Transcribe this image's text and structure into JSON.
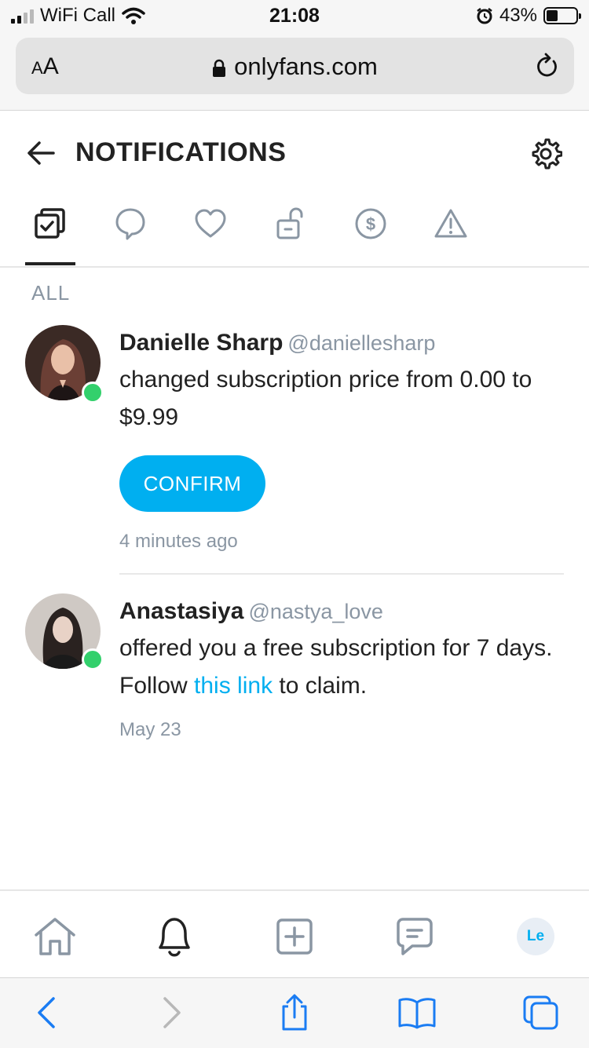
{
  "status_bar": {
    "carrier": "WiFi Call",
    "time": "21:08",
    "battery": "43%"
  },
  "browser": {
    "text_size_label_small": "A",
    "text_size_label_large": "A",
    "url": "onlyfans.com"
  },
  "header": {
    "title": "NOTIFICATIONS"
  },
  "tabs": [
    {
      "icon": "all-notifications-icon",
      "active": true
    },
    {
      "icon": "comment-icon",
      "active": false
    },
    {
      "icon": "heart-icon",
      "active": false
    },
    {
      "icon": "unlock-icon",
      "active": false
    },
    {
      "icon": "dollar-icon",
      "active": false
    },
    {
      "icon": "warning-icon",
      "active": false
    }
  ],
  "section": {
    "label": "ALL"
  },
  "notifications": [
    {
      "name": "Danielle Sharp",
      "handle": "@daniellesharp",
      "text": "changed subscription price from 0.00 to $9.99",
      "button": "CONFIRM",
      "time": "4 minutes ago",
      "online": true
    },
    {
      "name": "Anastasiya",
      "handle": "@nastya_love",
      "text_before": "offered you a free subscription for 7 days. Follow ",
      "link": "this link",
      "text_after": " to claim.",
      "time": "May 23",
      "online": true
    }
  ],
  "app_nav": {
    "profile_initials": "Le"
  },
  "colors": {
    "accent": "#00aff0",
    "online": "#33d06c",
    "muted": "#8a96a3",
    "safari_blue": "#1a7cf3"
  }
}
